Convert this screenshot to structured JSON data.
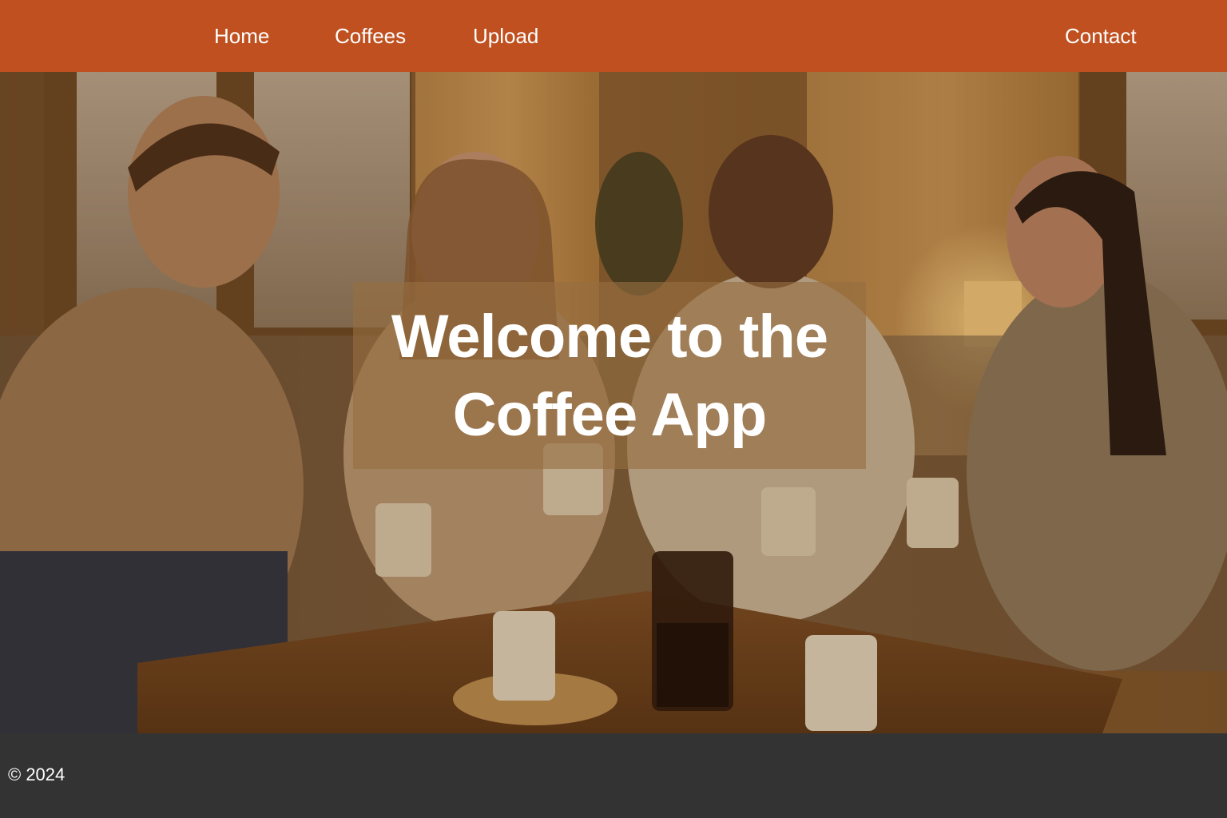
{
  "nav": {
    "home": "Home",
    "coffees": "Coffees",
    "upload": "Upload",
    "contact": "Contact"
  },
  "hero": {
    "title_line1": "Welcome to the",
    "title_line2": "Coffee App",
    "image_icon": "photo-friends-drinking-coffee"
  },
  "footer": {
    "copyright": "© 2024"
  },
  "colors": {
    "nav_background": "#c0501f",
    "footer_background": "#333333",
    "text": "#ffffff"
  }
}
